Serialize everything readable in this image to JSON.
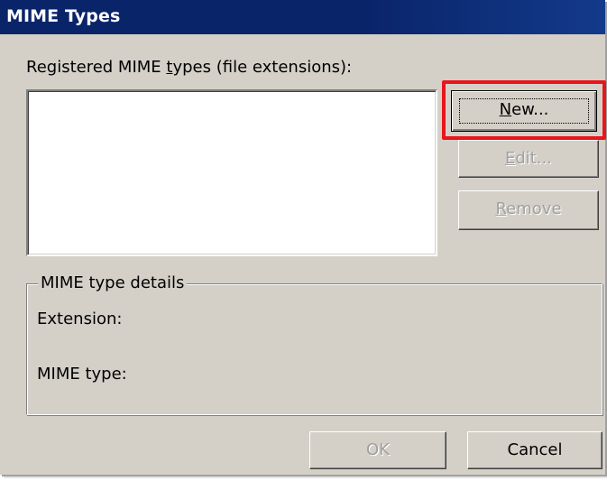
{
  "window": {
    "title": "MIME Types"
  },
  "list": {
    "label_before": "Registered MIME ",
    "label_accel": "t",
    "label_after": "ypes (file extensions):",
    "items": []
  },
  "buttons": {
    "new": {
      "accel": "N",
      "rest": "ew...",
      "enabled": true,
      "focused": true
    },
    "edit": {
      "accel": "E",
      "rest": "dit...",
      "enabled": false
    },
    "remove": {
      "accel": "R",
      "rest": "emove",
      "enabled": false
    },
    "ok": {
      "label": "OK",
      "enabled": false
    },
    "cancel": {
      "label": "Cancel",
      "enabled": true
    }
  },
  "details": {
    "legend": "MIME type details",
    "extension_label": "Extension:",
    "mime_type_label": "MIME type:"
  },
  "colors": {
    "titlebar": "#0a246a",
    "dialog_bg": "#d4d0c8",
    "highlight": "#e8161c"
  }
}
